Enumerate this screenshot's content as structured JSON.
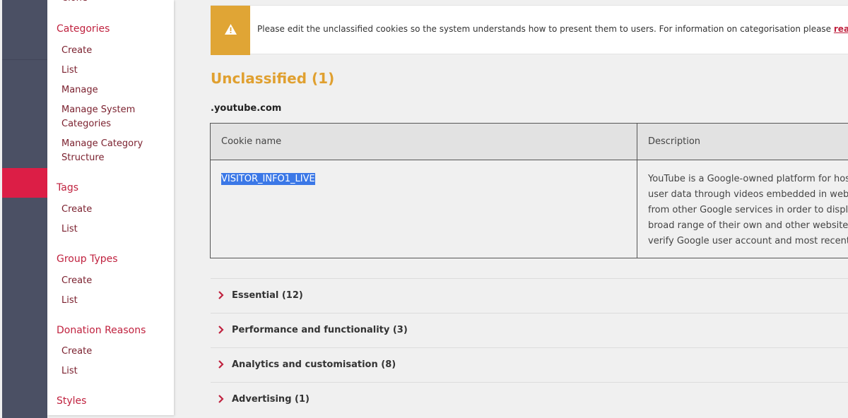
{
  "colors": {
    "rail": "#4b5064",
    "rail_active": "#dc1e46",
    "brand_red": "#c0223f",
    "menu_item": "#7a1f2d",
    "warning": "#e0a535",
    "title_orange": "#e0a030"
  },
  "sidebar": {
    "partial_top_item": "Clone",
    "sections": [
      {
        "heading": "Categories",
        "items": [
          "Create",
          "List",
          "Manage",
          "Manage System Categories",
          "Manage Category Structure"
        ]
      },
      {
        "heading": "Tags",
        "items": [
          "Create",
          "List"
        ]
      },
      {
        "heading": "Group Types",
        "items": [
          "Create",
          "List"
        ]
      },
      {
        "heading": "Donation Reasons",
        "items": [
          "Create",
          "List"
        ]
      },
      {
        "heading": "Styles",
        "items": []
      }
    ]
  },
  "alert": {
    "icon": "warning-triangle-icon",
    "text": "Please edit the unclassified cookies so the system understands how to present them to users. For information on categorisation please ",
    "link_text": "read this a"
  },
  "unclassified": {
    "title": "Unclassified (1)",
    "domain": ".youtube.com",
    "table": {
      "headers": [
        "Cookie name",
        "Description"
      ],
      "rows": [
        {
          "name": "VISITOR_INFO1_LIVE",
          "description_lines": [
            "YouTube is a Google-owned platform for hos",
            "user data through videos embedded in webs",
            "from other Google services in order to displa",
            "broad range of their own and other websites",
            "verify Google user account and most recent l"
          ]
        }
      ]
    }
  },
  "categories": [
    {
      "label": "Essential (12)",
      "icon": "chevron-right-icon"
    },
    {
      "label": "Performance and functionality (3)",
      "icon": "chevron-right-icon"
    },
    {
      "label": "Analytics and customisation (8)",
      "icon": "chevron-right-icon"
    },
    {
      "label": "Advertising (1)",
      "icon": "chevron-right-icon"
    }
  ]
}
